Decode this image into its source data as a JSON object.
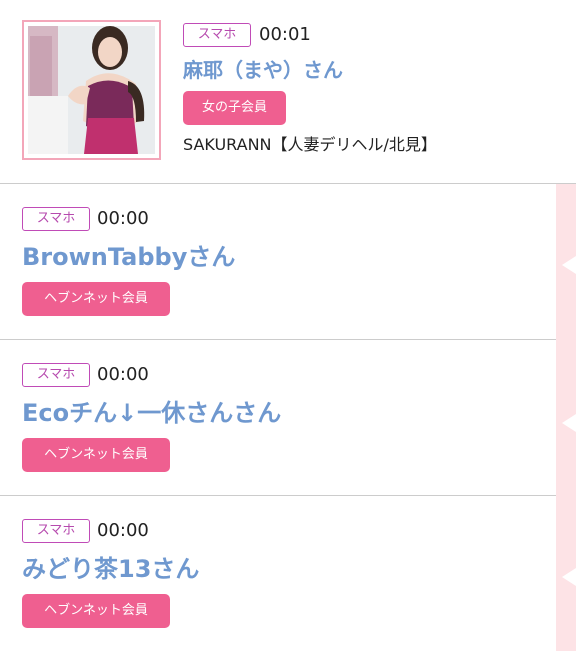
{
  "entries": [
    {
      "device": "スマホ",
      "time": "00:01",
      "name": "麻耶（まや）さん",
      "member_type": "女の子会員",
      "shop": "SAKURANN【人妻デリヘル/北見】"
    },
    {
      "device": "スマホ",
      "time": "00:00",
      "name": "BrownTabbyさん",
      "member_type": "ヘブンネット会員"
    },
    {
      "device": "スマホ",
      "time": "00:00",
      "name": "Ecoチん↓一休さんさん",
      "member_type": "ヘブンネット会員"
    },
    {
      "device": "スマホ",
      "time": "00:00",
      "name": "みどり茶13さん",
      "member_type": "ヘブンネット会員"
    }
  ],
  "colors": {
    "accent_pink": "#ef5f90",
    "device_badge": "#c04bb7",
    "name_blue": "#6f98cf",
    "side_strip": "#fde3e6"
  }
}
